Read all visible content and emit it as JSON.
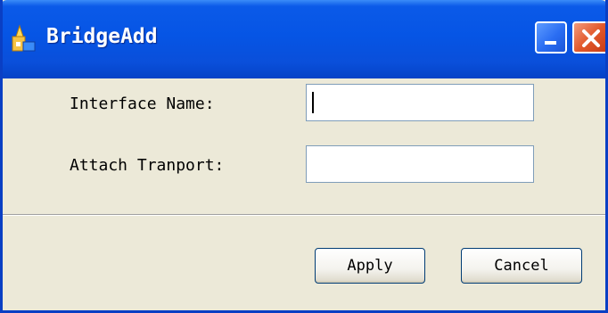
{
  "window": {
    "title": "BridgeAdd",
    "icon": "app-folder-icon",
    "title_buttons": {
      "minimize": "minimize-icon",
      "close": "close-icon"
    }
  },
  "form": {
    "interface_name_label": "Interface Name:",
    "interface_name_value": "",
    "attach_transport_label": "Attach Tranport:",
    "attach_transport_value": ""
  },
  "buttons": {
    "apply": "Apply",
    "cancel": "Cancel"
  },
  "colors": {
    "titlebar": "#0655e5",
    "dialog_bg": "#ece9d8",
    "close_button": "#e2582a",
    "input_border": "#7f9db9"
  }
}
